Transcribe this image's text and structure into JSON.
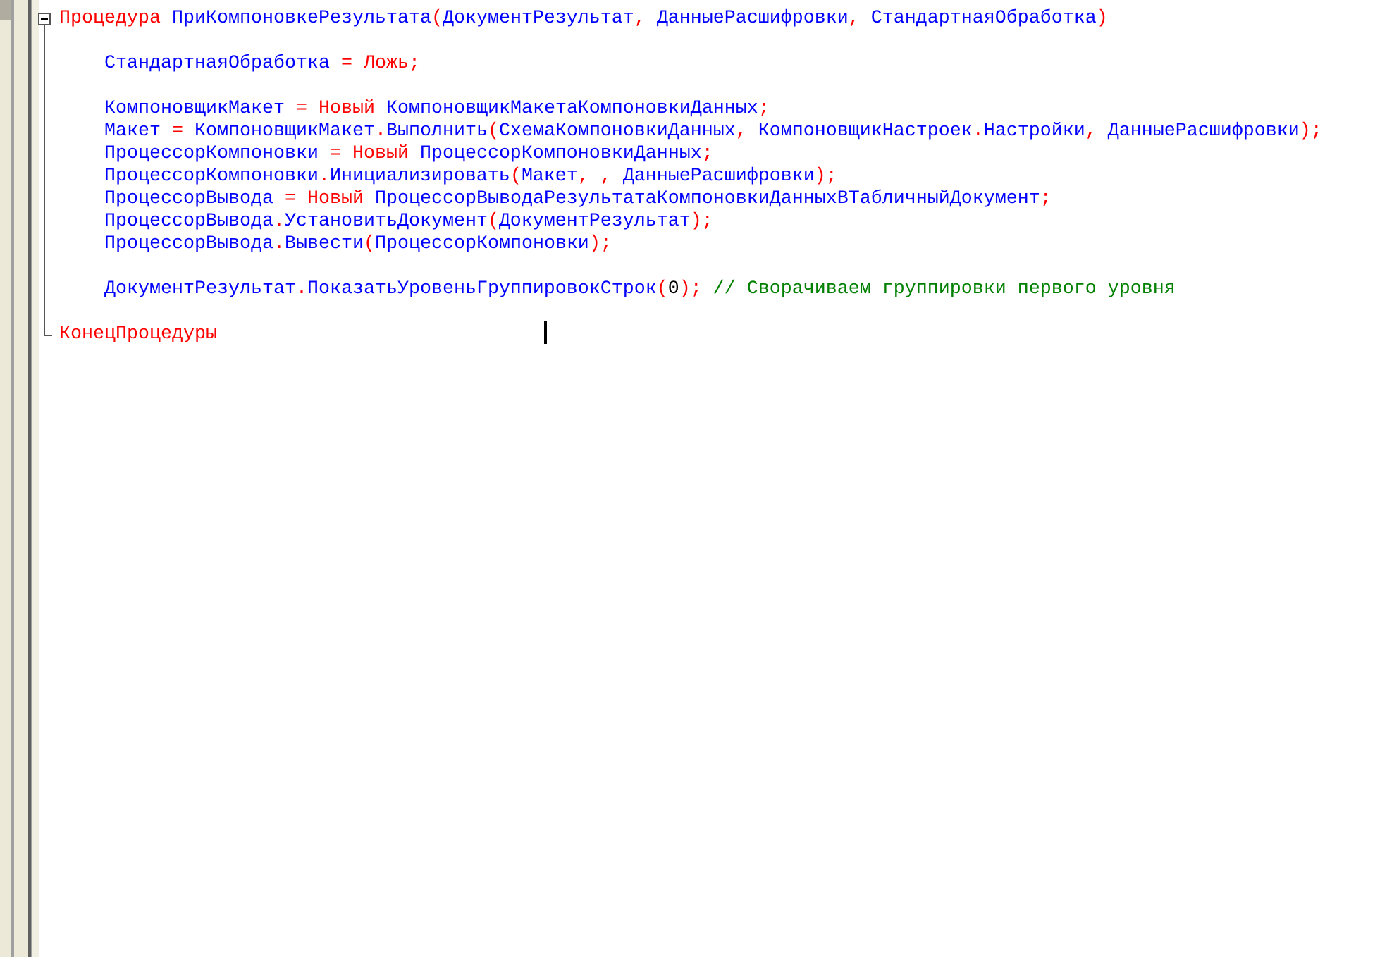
{
  "procedure": {
    "expanded": true,
    "header": [
      {
        "kind": "keyword",
        "text": "Процедура "
      },
      {
        "kind": "ident",
        "text": "ПриКомпоновкеРезультата"
      },
      {
        "kind": "op",
        "text": "("
      },
      {
        "kind": "ident",
        "text": "ДокументРезультат"
      },
      {
        "kind": "op",
        "text": ", "
      },
      {
        "kind": "ident",
        "text": "ДанныеРасшифровки"
      },
      {
        "kind": "op",
        "text": ", "
      },
      {
        "kind": "ident",
        "text": "СтандартнаяОбработка"
      },
      {
        "kind": "op",
        "text": ")"
      }
    ],
    "body": [
      {
        "kind": "blank"
      },
      {
        "kind": "code",
        "tokens": [
          {
            "kind": "ident",
            "text": "СтандартнаяОбработка"
          },
          {
            "kind": "op",
            "text": " = "
          },
          {
            "kind": "keyword",
            "text": "Ложь"
          },
          {
            "kind": "op",
            "text": ";"
          }
        ]
      },
      {
        "kind": "blank"
      },
      {
        "kind": "code",
        "tokens": [
          {
            "kind": "ident",
            "text": "КомпоновщикМакет"
          },
          {
            "kind": "op",
            "text": " = "
          },
          {
            "kind": "keyword",
            "text": "Новый"
          },
          {
            "kind": "ident",
            "text": " КомпоновщикМакетаКомпоновкиДанных"
          },
          {
            "kind": "op",
            "text": ";"
          }
        ]
      },
      {
        "kind": "code",
        "tokens": [
          {
            "kind": "ident",
            "text": "Макет"
          },
          {
            "kind": "op",
            "text": " = "
          },
          {
            "kind": "ident",
            "text": "КомпоновщикМакет"
          },
          {
            "kind": "op",
            "text": "."
          },
          {
            "kind": "ident",
            "text": "Выполнить"
          },
          {
            "kind": "op",
            "text": "("
          },
          {
            "kind": "ident",
            "text": "СхемаКомпоновкиДанных"
          },
          {
            "kind": "op",
            "text": ", "
          },
          {
            "kind": "ident",
            "text": "КомпоновщикНастроек"
          },
          {
            "kind": "op",
            "text": "."
          },
          {
            "kind": "ident",
            "text": "Настройки"
          },
          {
            "kind": "op",
            "text": ", "
          },
          {
            "kind": "ident",
            "text": "ДанныеРасшифровки"
          },
          {
            "kind": "op",
            "text": ");"
          }
        ]
      },
      {
        "kind": "code",
        "tokens": [
          {
            "kind": "ident",
            "text": "ПроцессорКомпоновки"
          },
          {
            "kind": "op",
            "text": " = "
          },
          {
            "kind": "keyword",
            "text": "Новый"
          },
          {
            "kind": "ident",
            "text": " ПроцессорКомпоновкиДанных"
          },
          {
            "kind": "op",
            "text": ";"
          }
        ]
      },
      {
        "kind": "code",
        "tokens": [
          {
            "kind": "ident",
            "text": "ПроцессорКомпоновки"
          },
          {
            "kind": "op",
            "text": "."
          },
          {
            "kind": "ident",
            "text": "Инициализировать"
          },
          {
            "kind": "op",
            "text": "("
          },
          {
            "kind": "ident",
            "text": "Макет"
          },
          {
            "kind": "op",
            "text": ", , "
          },
          {
            "kind": "ident",
            "text": "ДанныеРасшифровки"
          },
          {
            "kind": "op",
            "text": ");"
          }
        ]
      },
      {
        "kind": "code",
        "tokens": [
          {
            "kind": "ident",
            "text": "ПроцессорВывода"
          },
          {
            "kind": "op",
            "text": " = "
          },
          {
            "kind": "keyword",
            "text": "Новый"
          },
          {
            "kind": "ident",
            "text": " ПроцессорВыводаРезультатаКомпоновкиДанныхВТабличныйДокумент"
          },
          {
            "kind": "op",
            "text": ";"
          }
        ]
      },
      {
        "kind": "code",
        "tokens": [
          {
            "kind": "ident",
            "text": "ПроцессорВывода"
          },
          {
            "kind": "op",
            "text": "."
          },
          {
            "kind": "ident",
            "text": "УстановитьДокумент"
          },
          {
            "kind": "op",
            "text": "("
          },
          {
            "kind": "ident",
            "text": "ДокументРезультат"
          },
          {
            "kind": "op",
            "text": ");"
          }
        ]
      },
      {
        "kind": "code",
        "tokens": [
          {
            "kind": "ident",
            "text": "ПроцессорВывода"
          },
          {
            "kind": "op",
            "text": "."
          },
          {
            "kind": "ident",
            "text": "Вывести"
          },
          {
            "kind": "op",
            "text": "("
          },
          {
            "kind": "ident",
            "text": "ПроцессорКомпоновки"
          },
          {
            "kind": "op",
            "text": ");"
          }
        ]
      },
      {
        "kind": "blank"
      },
      {
        "kind": "code",
        "tokens": [
          {
            "kind": "ident",
            "text": "ДокументРезультат"
          },
          {
            "kind": "op",
            "text": "."
          },
          {
            "kind": "ident",
            "text": "ПоказатьУровеньГруппировокСтрок"
          },
          {
            "kind": "op",
            "text": "("
          },
          {
            "kind": "number",
            "text": "0"
          },
          {
            "kind": "op",
            "text": "); "
          },
          {
            "kind": "comment",
            "text": "// Сворачиваем группировки первого уровня"
          }
        ]
      },
      {
        "kind": "blank"
      }
    ],
    "footer": [
      {
        "kind": "keyword",
        "text": "КонецПроцедуры"
      }
    ]
  }
}
